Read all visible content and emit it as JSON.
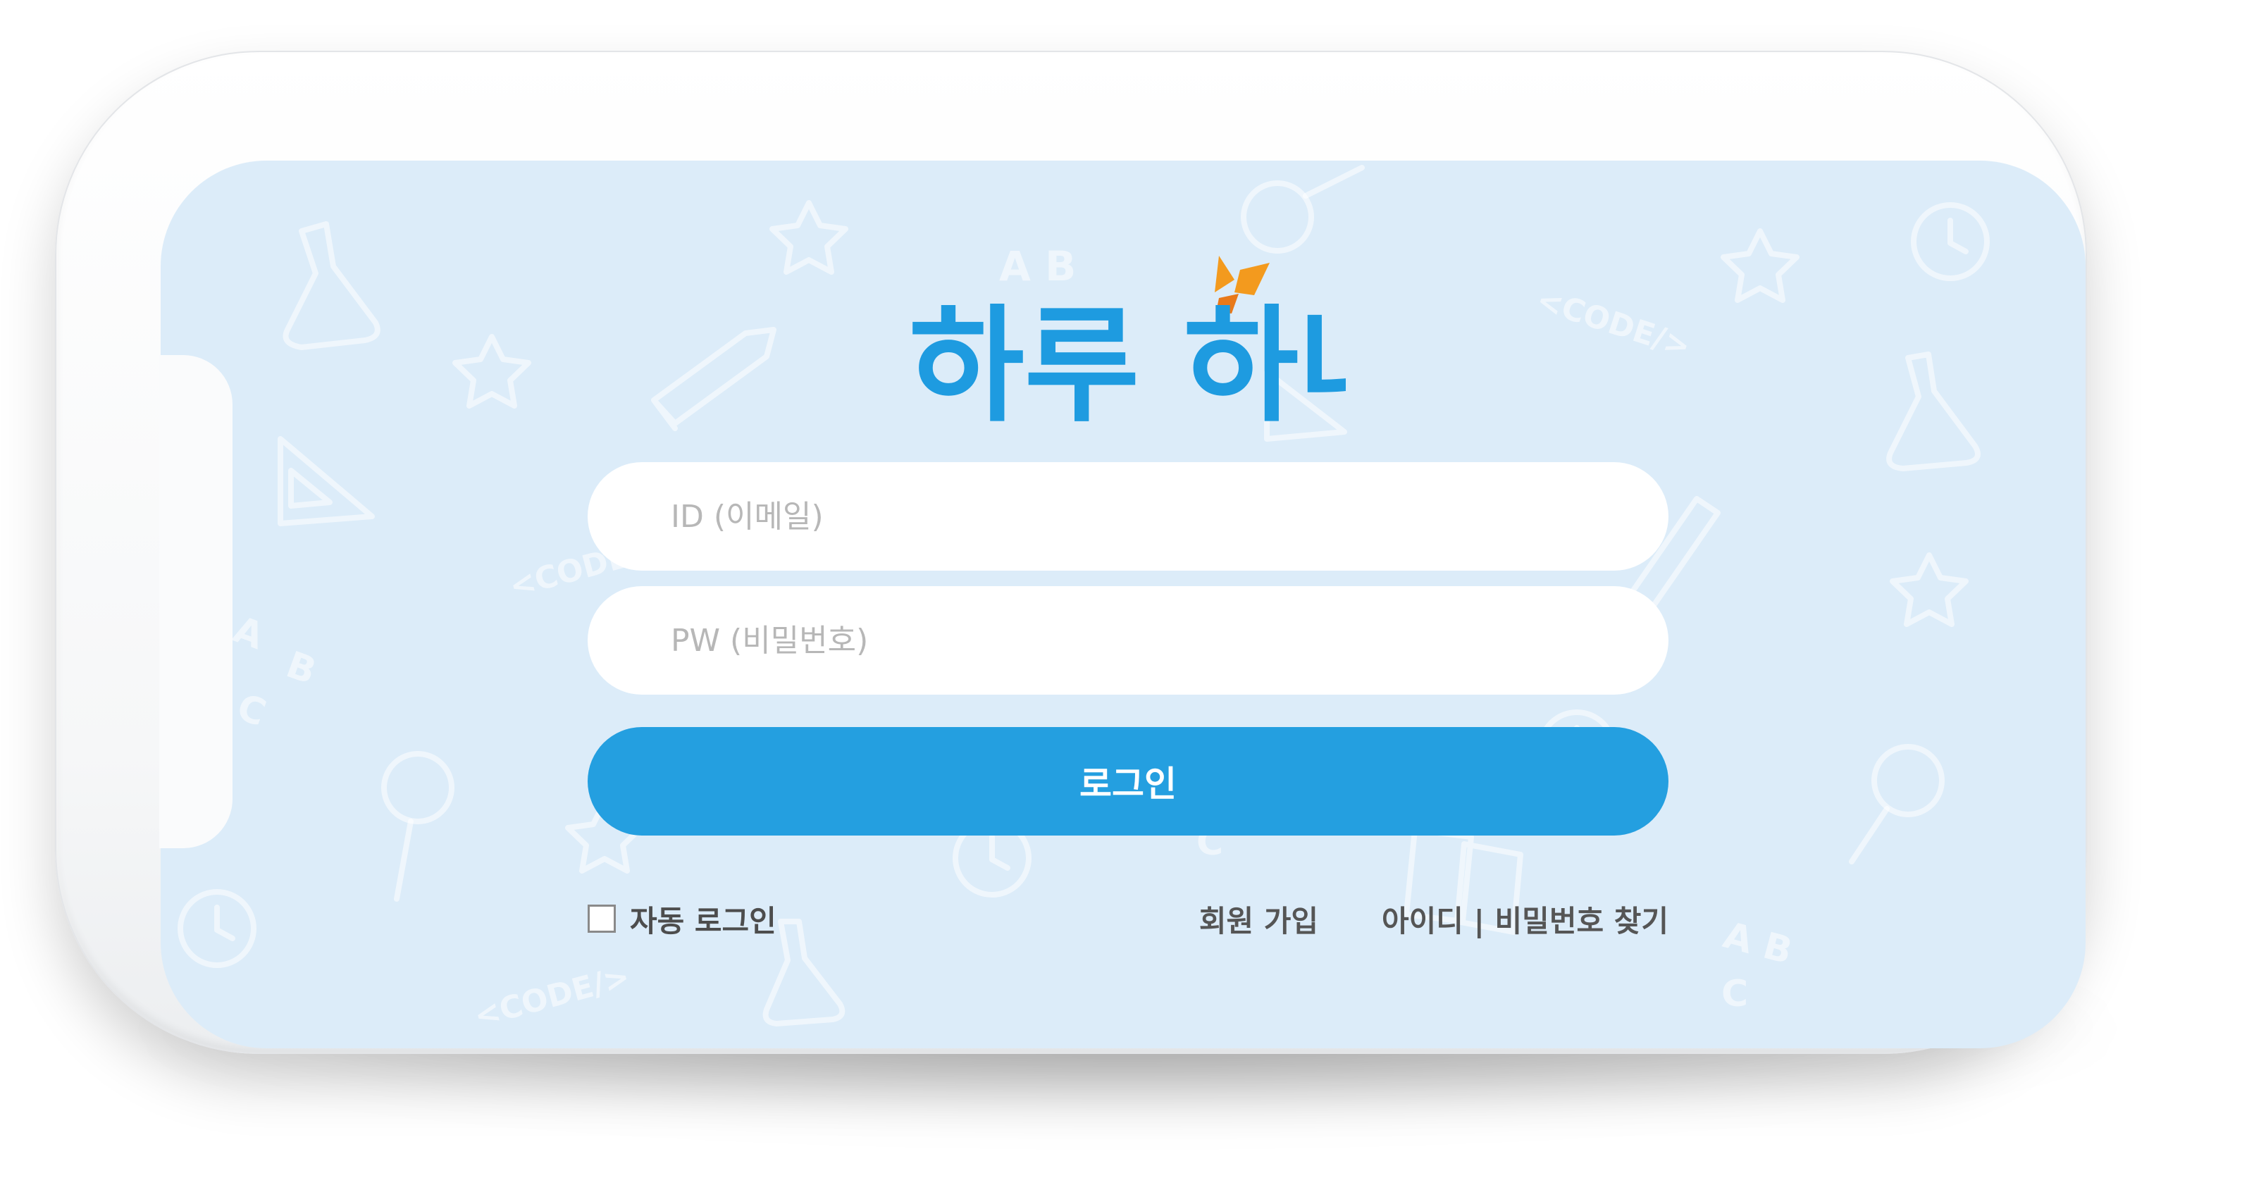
{
  "app": {
    "logo_text": "하루 하나"
  },
  "login_form": {
    "id_placeholder": "ID (이메일)",
    "pw_placeholder": "PW (비밀번호)",
    "login_button": "로그인",
    "auto_login_label": "자동 로그인",
    "auto_login_checked": false,
    "signup_link": "회원 가입",
    "find_link": "아이디 | 비밀번호 찾기"
  },
  "colors": {
    "screen_background": "#dcecf9",
    "primary": "#249fe0",
    "logo_blue": "#1e9be0",
    "logo_orange": "#f39a1e"
  }
}
